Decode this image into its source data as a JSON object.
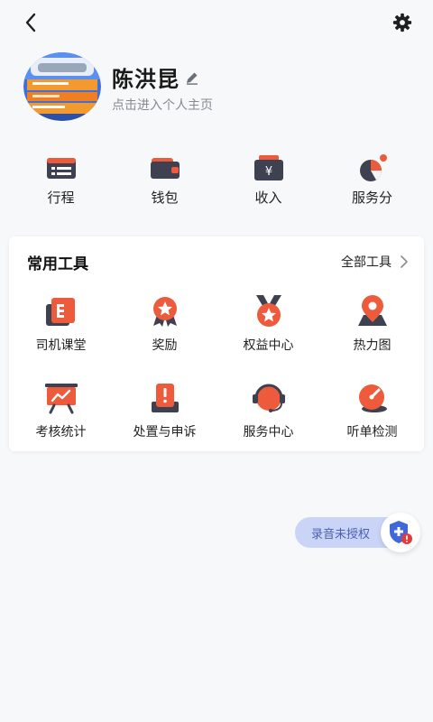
{
  "header": {
    "back_icon": "chevron-left-icon",
    "settings_icon": "gear-icon"
  },
  "profile": {
    "name": "陈洪昆",
    "subtitle": "点击进入个人主页",
    "edit_icon": "pencil-icon"
  },
  "quick_links": [
    {
      "label": "行程",
      "icon": "itinerary-icon"
    },
    {
      "label": "钱包",
      "icon": "wallet-icon"
    },
    {
      "label": "收入",
      "icon": "income-icon"
    },
    {
      "label": "服务分",
      "icon": "service-score-icon",
      "has_badge": true
    }
  ],
  "tools": {
    "title": "常用工具",
    "all_label": "全部工具",
    "items": [
      {
        "label": "司机课堂",
        "icon": "book-icon"
      },
      {
        "label": "奖励",
        "icon": "reward-icon"
      },
      {
        "label": "权益中心",
        "icon": "medal-icon"
      },
      {
        "label": "热力图",
        "icon": "map-pin-icon"
      },
      {
        "label": "考核统计",
        "icon": "chart-board-icon"
      },
      {
        "label": "处置与申诉",
        "icon": "appeal-icon"
      },
      {
        "label": "服务中心",
        "icon": "headset-icon"
      },
      {
        "label": "听单检测",
        "icon": "gauge-icon"
      }
    ]
  },
  "recording": {
    "label": "录音未授权",
    "icon": "shield-alert-icon"
  },
  "colors": {
    "accent": "#ee5a3c",
    "dark": "#3d4150",
    "pill_bg": "#c9d4f7",
    "pill_text": "#4a5fb5",
    "background": "#f7f8fa"
  }
}
